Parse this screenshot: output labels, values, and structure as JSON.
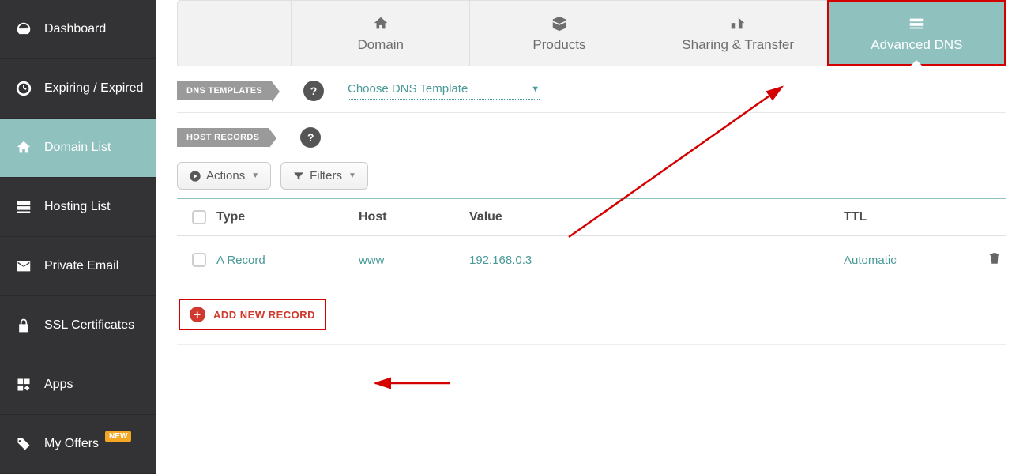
{
  "sidebar": {
    "items": [
      {
        "label": "Dashboard"
      },
      {
        "label": "Expiring / Expired"
      },
      {
        "label": "Domain List"
      },
      {
        "label": "Hosting List"
      },
      {
        "label": "Private Email"
      },
      {
        "label": "SSL Certificates"
      },
      {
        "label": "Apps"
      },
      {
        "label": "My Offers",
        "badge": "NEW"
      }
    ]
  },
  "tabs": {
    "domain": "Domain",
    "products": "Products",
    "sharing": "Sharing & Transfer",
    "advanced_dns": "Advanced DNS"
  },
  "sections": {
    "dns_templates_label": "DNS TEMPLATES",
    "host_records_label": "HOST RECORDS",
    "choose_template": "Choose DNS Template"
  },
  "actionbar": {
    "actions": "Actions",
    "filters": "Filters"
  },
  "table": {
    "headers": {
      "type": "Type",
      "host": "Host",
      "value": "Value",
      "ttl": "TTL"
    },
    "rows": [
      {
        "type": "A Record",
        "host": "www",
        "value": "192.168.0.3",
        "ttl": "Automatic"
      }
    ],
    "add_new": "ADD NEW RECORD"
  }
}
